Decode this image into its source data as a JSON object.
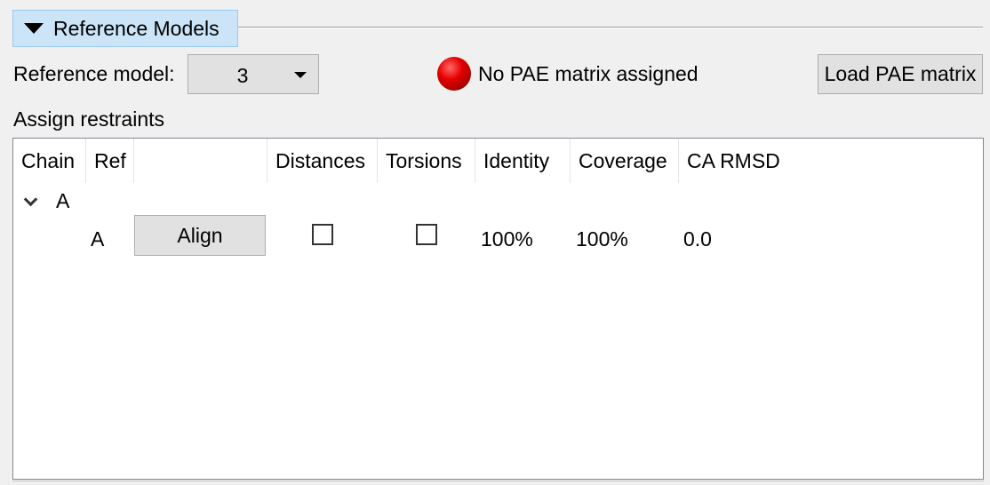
{
  "section": {
    "title": "Reference Models",
    "expanded": true
  },
  "reference": {
    "label": "Reference model:",
    "selected": "3"
  },
  "pae": {
    "status_text": "No PAE matrix assigned",
    "status_color": "#e60000",
    "load_button": "Load PAE matrix"
  },
  "assign": {
    "label": "Assign restraints"
  },
  "table": {
    "columns": [
      "Chain",
      "Ref",
      "",
      "Distances",
      "Torsions",
      "Identity",
      "Coverage",
      "CA RMSD"
    ],
    "groups": [
      {
        "chain": "A",
        "expanded": true,
        "rows": [
          {
            "ref": "A",
            "align_label": "Align",
            "distances": false,
            "torsions": false,
            "identity": "100%",
            "coverage": "100%",
            "ca_rmsd": "0.0"
          }
        ]
      }
    ]
  },
  "colors": {
    "header_bg": "#cce4f7",
    "button_bg": "#e1e1e1",
    "window_bg": "#f0f0f0"
  }
}
